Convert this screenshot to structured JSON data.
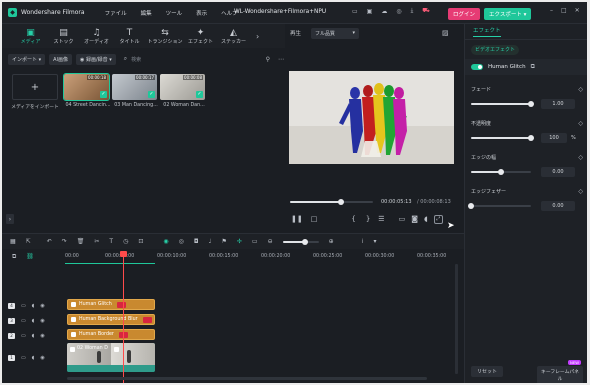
{
  "app": {
    "name": "Wondershare Filmora",
    "title": "WL-Wondershare+Filmora+NPU",
    "menu": [
      "ファイル",
      "編集",
      "ツール",
      "表示",
      "ヘルプ"
    ],
    "login_label": "ログイン",
    "export_label": "エクスポート ▾"
  },
  "media_tabs": [
    {
      "label": "メディア",
      "icon": "folder-icon",
      "glyph": "▣",
      "active": true
    },
    {
      "label": "ストック",
      "icon": "stock-icon",
      "glyph": "▤",
      "active": false
    },
    {
      "label": "オーディオ",
      "icon": "music-icon",
      "glyph": "♫",
      "active": false
    },
    {
      "label": "タイトル",
      "icon": "title-icon",
      "glyph": "T",
      "active": false
    },
    {
      "label": "トランジション",
      "icon": "transition-icon",
      "glyph": "⇆",
      "active": false
    },
    {
      "label": "エフェクト",
      "icon": "effect-icon",
      "glyph": "✦",
      "active": false
    },
    {
      "label": "ステッカー",
      "icon": "sticker-icon",
      "glyph": "◭",
      "active": false
    }
  ],
  "media_toolbar": {
    "import_label": "インポート ▾",
    "ai_label": "AI画像",
    "record_label": "◉ 録画/録音 ▾",
    "search_placeholder": "検索"
  },
  "media": {
    "import_tile_label": "メディアをインポート",
    "items": [
      {
        "label": "04 Street Dancin...",
        "duration": "00:00:18",
        "color": "#a7774c"
      },
      {
        "label": "03 Man Dancing...",
        "duration": "00:00:17",
        "color": "#9aa1a8"
      },
      {
        "label": "02 Woman Dan...",
        "duration": "00:00:08",
        "color": "#b8b6b0"
      }
    ]
  },
  "player": {
    "mode_label": "再生",
    "quality_label": "フル品質",
    "current_time": "00:00:05:13",
    "total_time": "/  00:00:08:13",
    "progress": 0.62
  },
  "right_panel": {
    "tab_label": "エフェクト",
    "chip_label": "ビデオエフェクト",
    "effect_name": "Human Glitch",
    "params": [
      {
        "label": "フェード",
        "value": "1.00",
        "fill": 1.0
      },
      {
        "label": "不透明度",
        "value": "100",
        "unit": "%",
        "fill": 1.0
      },
      {
        "label": "エッジの幅",
        "value": "0.00",
        "fill": 0.5
      },
      {
        "label": "エッジフェザー",
        "value": "0.00",
        "fill": 0.0
      }
    ],
    "reset_label": "リセット",
    "keyframe_label": "キーフレームパネル",
    "new_badge": "NEW"
  },
  "timeline": {
    "ruler": [
      "00:00",
      "00:00:05:00",
      "00:00:10:00",
      "00:00:15:00",
      "00:00:20:00",
      "00:00:25:00",
      "00:00:30:00",
      "00:00:35:00"
    ],
    "clips": [
      {
        "label": "Human Glitch"
      },
      {
        "label": "Human Background Blur"
      },
      {
        "label": "Human Border"
      }
    ],
    "video_clip_label": "02 Woman D",
    "track_numbers": [
      "4",
      "3",
      "2",
      "1"
    ]
  }
}
